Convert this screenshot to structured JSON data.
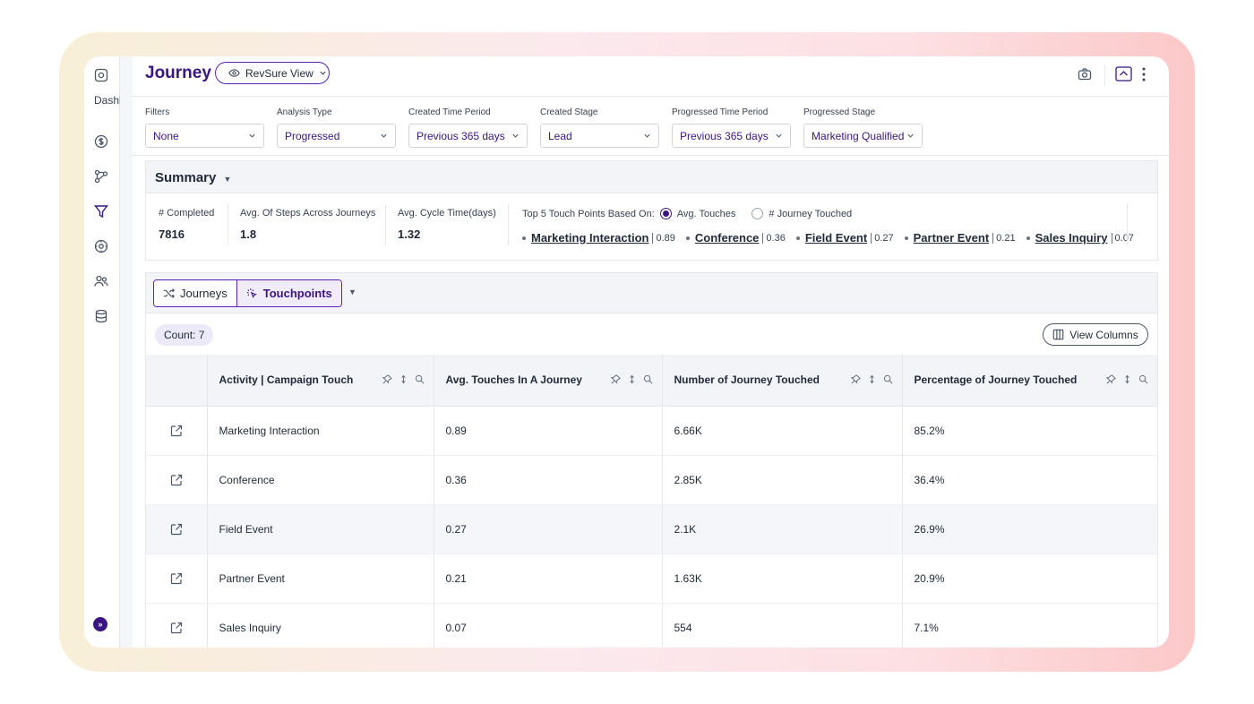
{
  "header": {
    "title": "Journey",
    "view_label": "RevSure View"
  },
  "sidebar": {
    "dash_label": "Dashl",
    "items": [
      "logo-icon",
      "dollar-icon",
      "route-icon",
      "funnel-icon",
      "settings-icon",
      "users-icon",
      "database-icon"
    ]
  },
  "filters": [
    {
      "label": "Filters",
      "value": "None"
    },
    {
      "label": "Analysis Type",
      "value": "Progressed"
    },
    {
      "label": "Created Time Period",
      "value": "Previous 365 days"
    },
    {
      "label": "Created Stage",
      "value": "Lead"
    },
    {
      "label": "Progressed Time Period",
      "value": "Previous 365 days"
    },
    {
      "label": "Progressed Stage",
      "value": "Marketing Qualified"
    }
  ],
  "summary": {
    "title": "Summary",
    "metrics": [
      {
        "label": "# Completed",
        "value": "7816"
      },
      {
        "label": "Avg. Of Steps Across Journeys",
        "value": "1.8"
      },
      {
        "label": "Avg. Cycle Time(days)",
        "value": "1.32"
      }
    ],
    "touch_header": "Top 5 Touch Points Based On:",
    "option_avg": "Avg. Touches",
    "option_journey": "# Journey Touched",
    "touchpoints": [
      {
        "name": "Marketing Interaction",
        "value": "0.89"
      },
      {
        "name": "Conference",
        "value": "0.36"
      },
      {
        "name": "Field Event",
        "value": "0.27"
      },
      {
        "name": "Partner Event",
        "value": "0.21"
      },
      {
        "name": "Sales Inquiry",
        "value": "0.07"
      }
    ]
  },
  "tabs": {
    "journeys": "Journeys",
    "touchpoints": "Touchpoints"
  },
  "count_label": "Count: 7",
  "view_columns": "View Columns",
  "table": {
    "columns": [
      "Activity | Campaign Touch",
      "Avg. Touches In A Journey",
      "Number of Journey Touched",
      "Percentage of Journey Touched"
    ],
    "rows": [
      [
        "Marketing Interaction",
        "0.89",
        "6.66K",
        "85.2%"
      ],
      [
        "Conference",
        "0.36",
        "2.85K",
        "36.4%"
      ],
      [
        "Field Event",
        "0.27",
        "2.1K",
        "26.9%"
      ],
      [
        "Partner Event",
        "0.21",
        "1.63K",
        "20.9%"
      ],
      [
        "Sales Inquiry",
        "0.07",
        "554",
        "7.1%"
      ]
    ]
  },
  "colors": {
    "accent": "#3b1582",
    "border_accent": "#5b21b6"
  }
}
